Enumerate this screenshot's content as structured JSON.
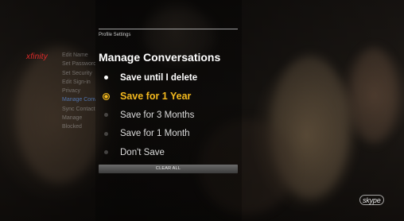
{
  "brand": "xfinity",
  "side_menu": {
    "items": [
      {
        "label": "Edit Name"
      },
      {
        "label": "Set Password"
      },
      {
        "label": "Set Security"
      },
      {
        "label": "Edit Sign-in"
      },
      {
        "label": "Privacy"
      },
      {
        "label": "Manage Conversations"
      },
      {
        "label": "Sync Contacts"
      },
      {
        "label": "Manage"
      },
      {
        "label": "Blocked"
      }
    ]
  },
  "breadcrumb": "Profile Settings",
  "title": "Manage Conversations",
  "options": [
    {
      "label": "Save until I delete"
    },
    {
      "label": "Save for 1 Year"
    },
    {
      "label": "Save for 3 Months"
    },
    {
      "label": "Save for 1 Month"
    },
    {
      "label": "Don't Save"
    }
  ],
  "clear_button": "CLEAR ALL",
  "skype_logo": "skype",
  "colors": {
    "accent": "#f2b81e",
    "brand_red": "#e02a2a"
  },
  "icons": {
    "option_marker": "radio-dot-icon",
    "selected_marker": "radio-selected-icon"
  }
}
